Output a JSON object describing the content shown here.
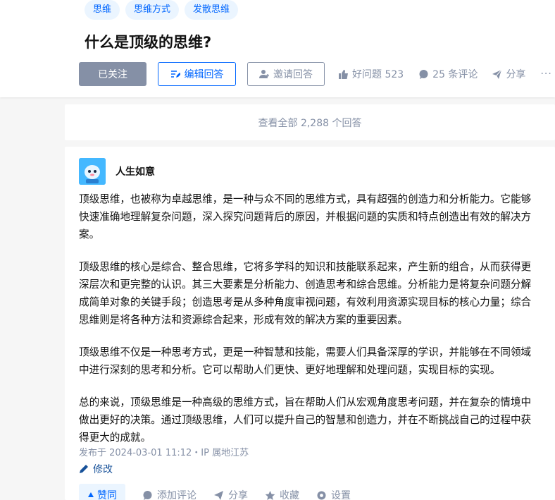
{
  "topics": [
    "思维",
    "思维方式",
    "发散思维"
  ],
  "question": {
    "title": "什么是顶级的思维?"
  },
  "actions": {
    "follow_label": "已关注",
    "edit_label": "编辑回答",
    "invite_label": "邀请回答",
    "good_question_label": "好问题 523",
    "comments_label": "25 条评论",
    "share_label": "分享",
    "more_label": "···"
  },
  "view_all": "查看全部 2,288 个回答",
  "answer": {
    "author": "人生如意",
    "paragraphs": [
      "顶级思维，也被称为卓越思维，是一种与众不同的思维方式，具有超强的创造力和分析能力。它能够快速准确地理解复杂问题，深入探究问题背后的原因，并根据问题的实质和特点创造出有效的解决方案。",
      "顶级思维的核心是综合、整合思维，它将多学科的知识和技能联系起来，产生新的组合，从而获得更深层次和更完整的认识。其三大要素是分析能力、创造思考和综合思维。分析能力是将复杂问题分解成简单对象的关键手段；创造思考是从多种角度审视问题，有效利用资源实现目标的核心力量；综合思维则是将各种方法和资源综合起来，形成有效的解决方案的重要因素。",
      "顶级思维不仅是一种思考方式，更是一种智慧和技能，需要人们具备深厚的学识，并能够在不同领域中进行深刻的思考和分析。它可以帮助人们更快、更好地理解和处理问题，实现目标的实现。",
      "总的来说，顶级思维是一种高级的思维方式，旨在帮助人们从宏观角度思考问题，并在复杂的情境中做出更好的决策。通过顶级思维，人们可以提升自己的智慧和创造力，并在不断挑战自己的过程中获得更大的成就。"
    ],
    "published": "发布于 2024-03-01 11:12・IP 属地江苏",
    "edit_label": "修改",
    "footer": {
      "vote_label": "赞同",
      "comment_label": "添加评论",
      "share_label": "分享",
      "collect_label": "收藏",
      "settings_label": "设置"
    }
  },
  "colors": {
    "brand_blue": "#0066ff",
    "muted_gray": "#8590a6",
    "link_blue": "#175199",
    "tag_bg": "#ebf5ff"
  }
}
